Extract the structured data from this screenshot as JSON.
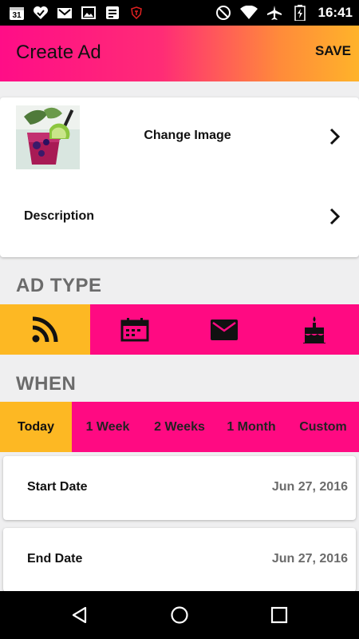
{
  "status_bar": {
    "calendar_day": "31",
    "time": "16:41",
    "left_icons": [
      "calendar-icon",
      "heart-check-icon",
      "gmail-icon",
      "image-icon",
      "notes-icon",
      "shield-icon"
    ],
    "right_icons": [
      "do-not-disturb-icon",
      "wifi-icon",
      "airplane-icon",
      "battery-icon"
    ]
  },
  "app_bar": {
    "title": "Create Ad",
    "save_label": "SAVE"
  },
  "image_card": {
    "change_image_label": "Change Image",
    "description_label": "Description"
  },
  "ad_type": {
    "section_title": "AD TYPE",
    "tabs": [
      {
        "icon": "rss-feed-icon",
        "active": true
      },
      {
        "icon": "calendar-event-icon",
        "active": false
      },
      {
        "icon": "mail-icon",
        "active": false
      },
      {
        "icon": "birthday-cake-icon",
        "active": false
      }
    ]
  },
  "when": {
    "section_title": "WHEN",
    "tabs": [
      {
        "label": "Today",
        "active": true
      },
      {
        "label": "1 Week",
        "active": false
      },
      {
        "label": "2 Weeks",
        "active": false
      },
      {
        "label": "1 Month",
        "active": false
      },
      {
        "label": "Custom",
        "active": false
      }
    ]
  },
  "dates": {
    "start_label": "Start Date",
    "start_value": "Jun 27, 2016",
    "end_label": "End Date",
    "end_value": "Jun 27, 2016"
  },
  "colors": {
    "accent_pink": "#ff0a82",
    "accent_yellow": "#fdb823",
    "gradient_start": "#ff0d87",
    "gradient_end": "#ffb32a"
  }
}
